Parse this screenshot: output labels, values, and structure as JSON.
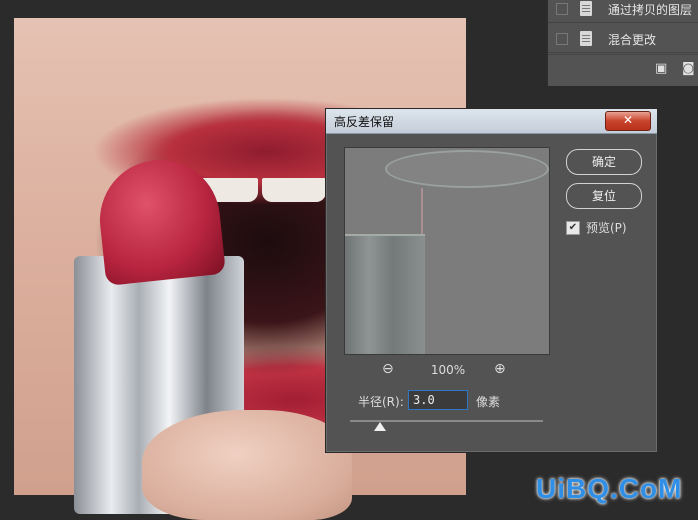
{
  "layers": {
    "items": [
      {
        "label": "通过拷贝的图层"
      },
      {
        "label": "混合更改"
      }
    ],
    "toolbar_icons": [
      "new-layer-icon",
      "camera-icon"
    ]
  },
  "dialog": {
    "title": "高反差保留",
    "close_label": "✕",
    "ok_label": "确定",
    "reset_label": "复位",
    "preview_label": "预览(P)",
    "preview_checked": true,
    "zoom_value": "100%",
    "radius_label": "半径(R):",
    "radius_value": "3.0",
    "radius_unit": "像素"
  },
  "watermark": "UiBQ.CoM"
}
